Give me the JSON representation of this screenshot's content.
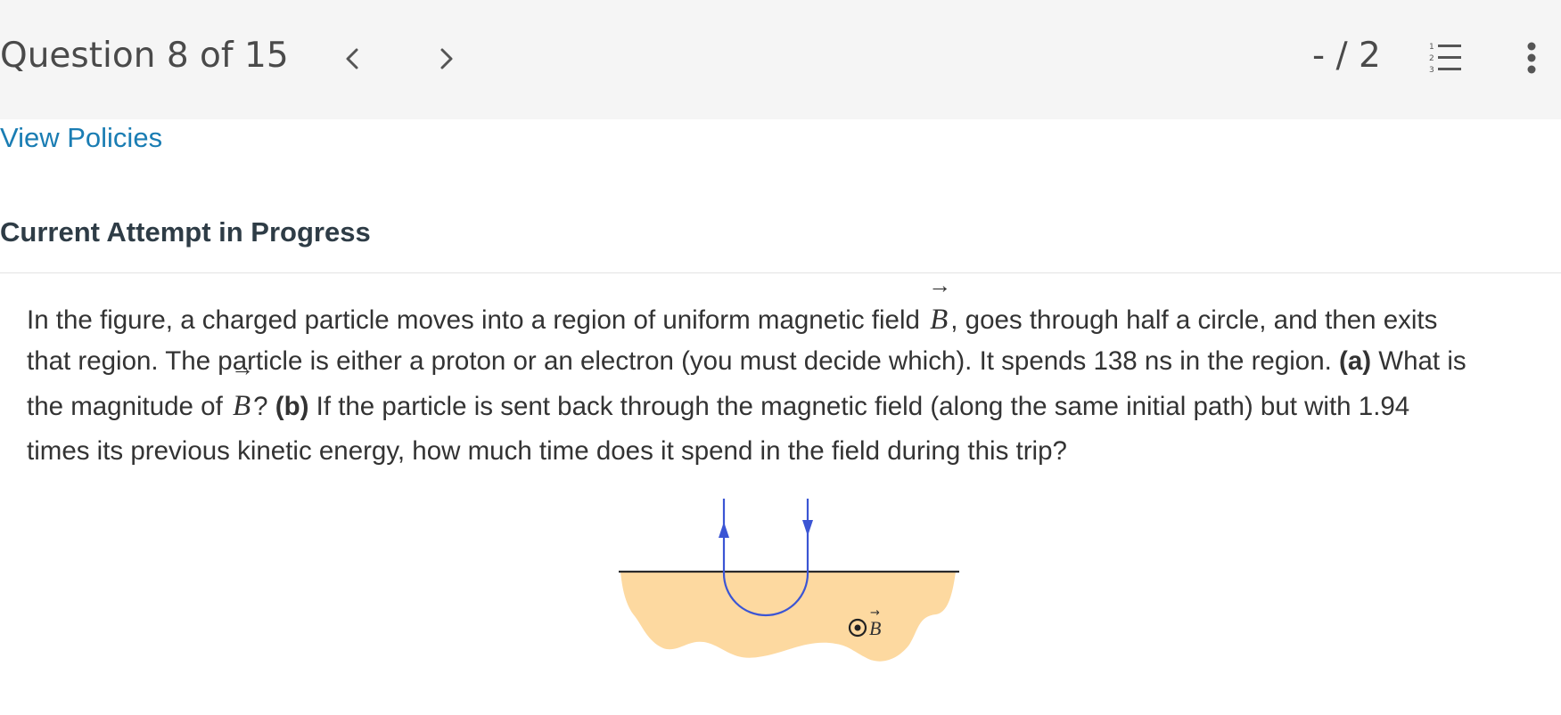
{
  "header": {
    "question_label": "Question 8 of 15",
    "score": "- / 2",
    "icons": {
      "prev": "chevron-left-icon",
      "next": "chevron-right-icon",
      "list": "numbered-list-icon",
      "more": "vertical-dots-icon"
    }
  },
  "links": {
    "view_policies": "View Policies"
  },
  "attempt": {
    "heading": "Current Attempt in Progress"
  },
  "question": {
    "line1_pre": "In the figure, a charged particle moves into a region of uniform magnetic field ",
    "vec_symbol": "B",
    "line1_post": ", goes through half a circle, and then exits",
    "line2": "that region. The particle is either a proton or an electron (you must decide which). It spends 138 ns in the region. ",
    "part_a_label": "(a)",
    "part_a_pre": " What is",
    "line3_pre": "the magnitude of ",
    "line3_q": "? ",
    "part_b_label": "(b)",
    "line3_post": " If the particle is sent back through the magnetic field (along the same initial path) but with 1.94",
    "line4": "times its previous kinetic energy, how much time does it spend in the field during this trip?"
  },
  "figure": {
    "field_label": "B",
    "region_color": "#fdd9a0",
    "path_color": "#3b55d4",
    "boundary_color": "#2a2a2a"
  },
  "colors": {
    "header_bg": "#f5f5f5",
    "link": "#1a7db3",
    "heading": "#2e3c46"
  }
}
